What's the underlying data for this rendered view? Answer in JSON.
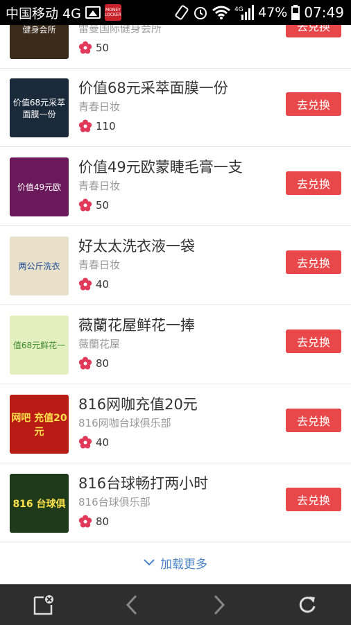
{
  "status_bar": {
    "carrier": "中国移动 4G",
    "app_icon_text": "MONEY LOCKER",
    "network": "4G",
    "battery": "47%",
    "time": "07:49"
  },
  "items": [
    {
      "title": "",
      "shop": "雷曼国际健身会所",
      "points": "50",
      "button": "去兑换",
      "thumb_text": "健身会所",
      "thumb_bg": "#3a2a1a"
    },
    {
      "title": "价值68元采萃面膜一份",
      "shop": "青春日妆",
      "points": "110",
      "button": "去兑换",
      "thumb_text": "价值68元采萃面膜一份",
      "thumb_bg": "#1b2a3a"
    },
    {
      "title": "价值49元欧蒙睫毛膏一支",
      "shop": "青春日妆",
      "points": "50",
      "button": "去兑换",
      "thumb_text": "价值49元欧",
      "thumb_bg": "#6a1a5a"
    },
    {
      "title": "好太太洗衣液一袋",
      "shop": "青春日妆",
      "points": "40",
      "button": "去兑换",
      "thumb_text": "两公斤洗衣",
      "thumb_bg": "#e8e0c8"
    },
    {
      "title": "薇蘭花屋鲜花一捧",
      "shop": "薇蘭花屋",
      "points": "80",
      "button": "去兑换",
      "thumb_text": "值68元鲜花一",
      "thumb_bg": "#e4efc0"
    },
    {
      "title": "816网咖充值20元",
      "shop": "816网咖台球俱乐部",
      "points": "40",
      "button": "去兑换",
      "thumb_text": "网吧 充值20元",
      "thumb_bg": "#b81c14"
    },
    {
      "title": "816台球畅打两小时",
      "shop": "816台球俱乐部",
      "points": "80",
      "button": "去兑换",
      "thumb_text": "816 台球俱",
      "thumb_bg": "#1e3a1a"
    }
  ],
  "load_more": "加载更多",
  "nav": {
    "icons": [
      "close-tab-icon",
      "back-arrow-icon",
      "forward-arrow-icon",
      "refresh-icon"
    ]
  },
  "colors": {
    "button": "#e8484a",
    "flower": "#e0395a",
    "link": "#4a84c8",
    "navbar": "#2e2e2e"
  }
}
